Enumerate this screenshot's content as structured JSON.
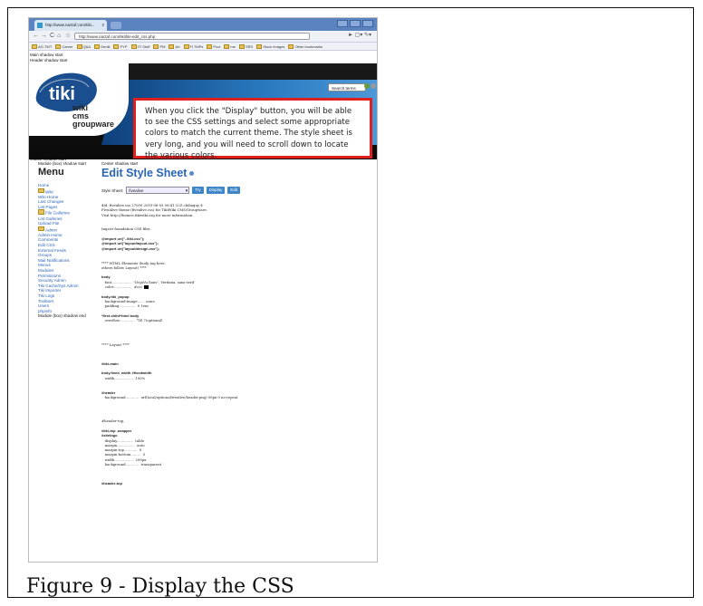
{
  "caption": "Figure 9 - Display the CSS",
  "browser": {
    "tab_title": "http://www.nactaf.com/tiki...",
    "tab_close": "x",
    "url": "http://www.nactaf.com/tiki/tiki-edit_css.php",
    "nav": {
      "back": "←",
      "forward": "→",
      "reload": "C",
      "home": "⌂",
      "star": "☆"
    },
    "toolbar_right": "► ▢▾ ✎▾",
    "bookmarks": [
      "AG-TMT",
      "Career",
      "Q&A",
      "Genlit",
      "PYP",
      "ITI Stuff",
      "PM",
      "Art",
      "Fi TMPs",
      "Pool",
      "me",
      "SRS",
      "Stock Images",
      "Other bookmarks"
    ]
  },
  "page": {
    "main_shadow_start": "Main shadow start",
    "header_shadow_start": "Header shadow start",
    "header_shadow_end": "Header shadow end",
    "middle_shadow_start": "Middle shadow start",
    "module_box_shadow_start": "Module (box) shadow start",
    "center_shadow_start": "Center shadow start",
    "search_label": "Search terms",
    "logo": {
      "tiki": "tiki",
      "line1": "wiki",
      "line2": "cms",
      "line3": "groupware"
    }
  },
  "callout_text": "When you click the \"Display\" button, you will be able to see the CSS settings and select some appropriate colors to match the current theme.  The style sheet is very long, and you will need to scroll down to locate the various colors.",
  "menu": {
    "title": "Menu",
    "items": [
      {
        "label": "Home",
        "folder": false,
        "dark": false
      },
      {
        "label": "Wiki",
        "folder": true,
        "dark": false
      },
      {
        "label": "Wiki Home",
        "folder": false,
        "dark": false
      },
      {
        "label": "Last Changes",
        "folder": false,
        "dark": false
      },
      {
        "label": "List Pages",
        "folder": false,
        "dark": false
      },
      {
        "label": "File Galleries",
        "folder": true,
        "dark": false
      },
      {
        "label": "List Galleries",
        "folder": false,
        "dark": false
      },
      {
        "label": "Upload File",
        "folder": false,
        "dark": false
      },
      {
        "label": "Admin",
        "folder": true,
        "dark": false
      },
      {
        "label": "Admin Home",
        "folder": false,
        "dark": false
      },
      {
        "label": "Comments",
        "folder": false,
        "dark": false
      },
      {
        "label": "Edit CSS",
        "folder": false,
        "dark": false
      },
      {
        "label": "External Feeds",
        "folder": false,
        "dark": false
      },
      {
        "label": "Groups",
        "folder": false,
        "dark": false
      },
      {
        "label": "Mail Notifications",
        "folder": false,
        "dark": false
      },
      {
        "label": "Menus",
        "folder": false,
        "dark": false
      },
      {
        "label": "Modules",
        "folder": false,
        "dark": false
      },
      {
        "label": "Permissions",
        "folder": false,
        "dark": false
      },
      {
        "label": "Security Admin",
        "folder": false,
        "dark": false
      },
      {
        "label": "Tiki Cache/Sys Admin",
        "folder": false,
        "dark": false
      },
      {
        "label": "Tiki Importer",
        "folder": false,
        "dark": false
      },
      {
        "label": "Tiki Logs",
        "folder": false,
        "dark": false
      },
      {
        "label": "Toolbars",
        "folder": false,
        "dark": false
      },
      {
        "label": "Users",
        "folder": false,
        "dark": false
      },
      {
        "label": "phpinfo",
        "folder": false,
        "dark": false
      },
      {
        "label": "Module (box) shadow end",
        "folder": false,
        "dark": true
      }
    ]
  },
  "editor": {
    "title": "Edit Style Sheet",
    "style_sheet_label": "Style Sheet:",
    "selected_sheet": "fivealive",
    "buttons": {
      "try": "Try",
      "display": "Display",
      "edit": "Edit"
    },
    "code_lines": [
      {
        "t": "$Id: fivealive.css 27000 2010-06-05 06:41:12Z chibaguy $",
        "b": false
      },
      {
        "t": "FiveAlive theme (fivealive.css) for TikiWiki CMS/Groupware.",
        "b": false
      },
      {
        "t": "Visit http://themes.tikiwiki.org for more information.",
        "b": false
      },
      {
        "t": "",
        "b": false
      },
      {
        "t": "",
        "b": false
      },
      {
        "t": "Import foundation CSS files.",
        "b": false
      },
      {
        "t": "",
        "b": false
      },
      {
        "t": "@import url(\"../tiki.css\");",
        "b": true
      },
      {
        "t": "@import url(\"layout/layout.css\");",
        "b": true
      },
      {
        "t": "@import url(\"layout/design.css\");",
        "b": true
      },
      {
        "t": "",
        "b": false
      },
      {
        "t": "",
        "b": false
      },
      {
        "t": "**** HTML Elements (body tag here,",
        "b": false
      },
      {
        "t": "others follow Layout) ****",
        "b": false
      },
      {
        "t": "",
        "b": false
      },
      {
        "t": "body",
        "b": true
      },
      {
        "t": "   font..................  \"DejaVu Sans\", Verdana, sans-serif",
        "b": false
      },
      {
        "t": "   color.................  #ccc",
        "b": false,
        "swatch": true
      },
      {
        "t": "",
        "b": false
      },
      {
        "t": "body.tiki_popup",
        "b": true
      },
      {
        "t": "   background-image......  none",
        "b": false
      },
      {
        "t": "   padding...............  0 1em",
        "b": false
      },
      {
        "t": "",
        "b": false
      },
      {
        "t": "*first-child+html body",
        "b": true
      },
      {
        "t": "   overflow..............  *IE 7(optional)",
        "b": false
      },
      {
        "t": "",
        "b": false
      },
      {
        "t": "",
        "b": false
      },
      {
        "t": "",
        "b": false
      },
      {
        "t": "",
        "b": false
      },
      {
        "t": "**** Layout ****",
        "b": false
      },
      {
        "t": "",
        "b": false
      },
      {
        "t": "",
        "b": false
      },
      {
        "t": "",
        "b": false
      },
      {
        "t": "#tiki-main",
        "b": true
      },
      {
        "t": "",
        "b": false
      },
      {
        "t": "body.fixed_width #fixedwidth",
        "b": true
      },
      {
        "t": "   width.................  100%",
        "b": false
      },
      {
        "t": "",
        "b": false
      },
      {
        "t": "",
        "b": false
      },
      {
        "t": "#header",
        "b": true
      },
      {
        "t": "   background............  url(local/options/fivealive/header.png) 50px 0 no-repeat",
        "b": false
      },
      {
        "t": "",
        "b": false
      },
      {
        "t": "",
        "b": false
      },
      {
        "t": "",
        "b": false
      },
      {
        "t": "",
        "b": false
      },
      {
        "t": "#header-top,",
        "b": false
      },
      {
        "t": "",
        "b": false
      },
      {
        "t": "#tiki-top .wrapper",
        "b": true
      },
      {
        "t": "#sitelogo",
        "b": true
      },
      {
        "t": "   display...............  table",
        "b": false
      },
      {
        "t": "   margin................  auto",
        "b": false
      },
      {
        "t": "   margin-top............  0",
        "b": false
      },
      {
        "t": "   margin-bottom.........  0",
        "b": false
      },
      {
        "t": "   width.................  200px",
        "b": false
      },
      {
        "t": "   background............  transparent",
        "b": false
      },
      {
        "t": "",
        "b": false
      },
      {
        "t": "",
        "b": false
      },
      {
        "t": "",
        "b": false
      },
      {
        "t": "#header-top",
        "b": true
      }
    ]
  }
}
